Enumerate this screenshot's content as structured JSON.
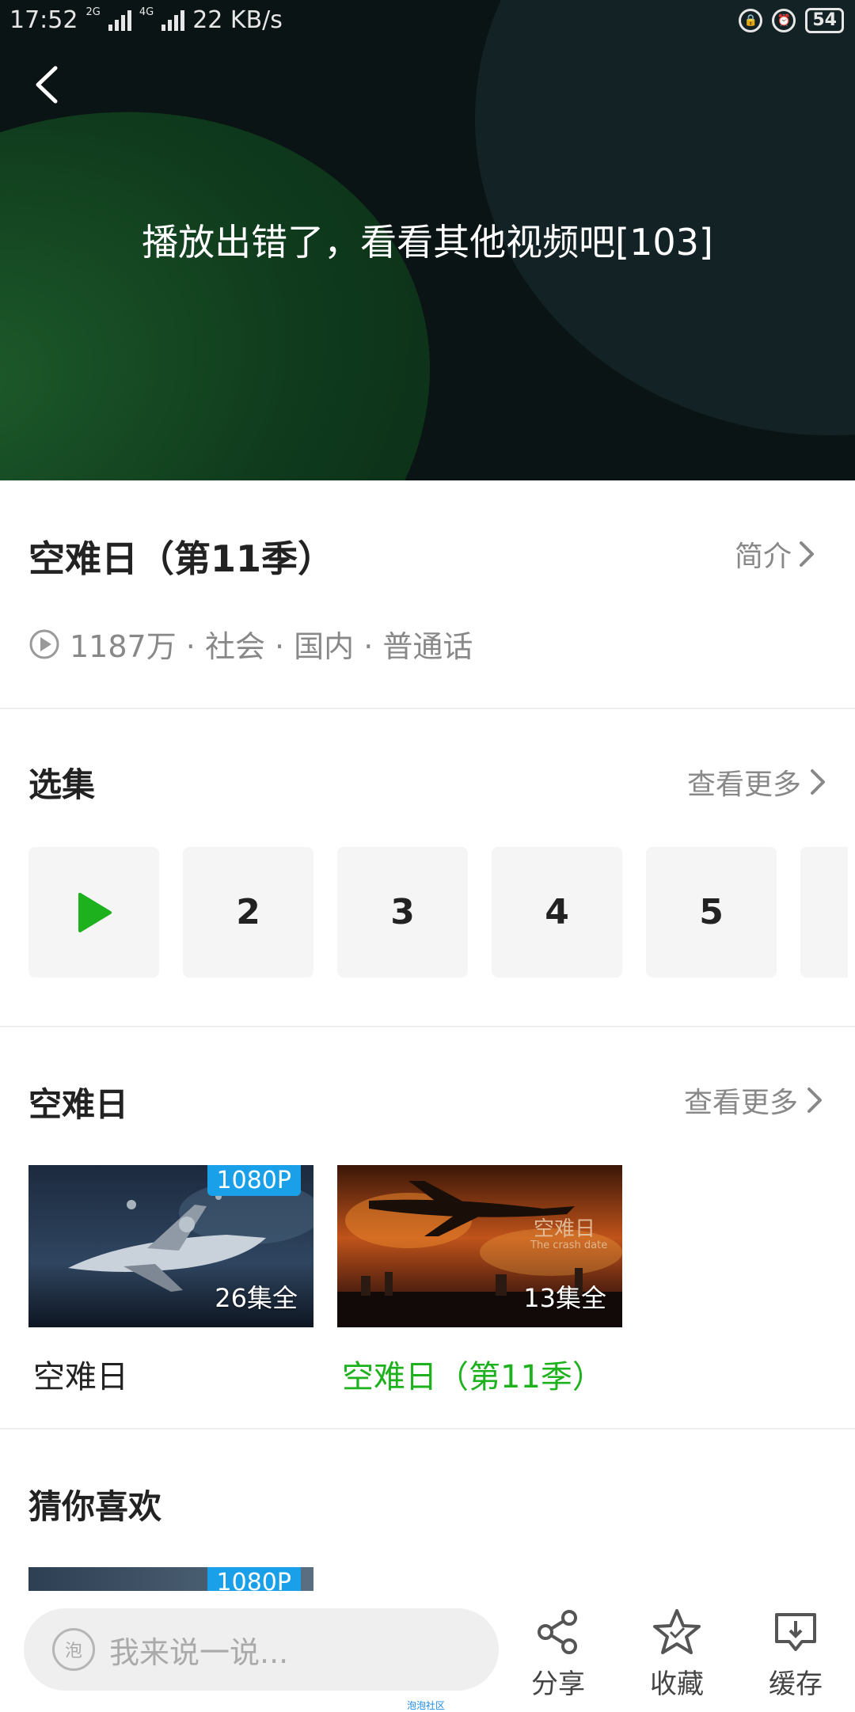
{
  "status_bar": {
    "time": "17:52",
    "net1": "2G",
    "net2": "4G",
    "speed": "22 KB/s",
    "battery": "54"
  },
  "player": {
    "error_text": "播放出错了，看看其他视频吧[103]"
  },
  "info": {
    "title": "空难日（第11季）",
    "intro_label": "简介",
    "meta": "1187万 · 社会 · 国内 · 普通话"
  },
  "episodes": {
    "title": "选集",
    "more_label": "查看更多",
    "items": [
      "2",
      "3",
      "4",
      "5"
    ],
    "accent": "#1db21d"
  },
  "related": {
    "title": "空难日",
    "more_label": "查看更多",
    "cards": [
      {
        "badge": "1080P",
        "count": "26集全",
        "title": "空难日"
      },
      {
        "count": "13集全",
        "title": "空难日（第11季）",
        "thumb_caption": "空难日",
        "thumb_caption_en": "The crash date"
      }
    ]
  },
  "recommend": {
    "title": "猜你喜欢",
    "peek_badge": "1080P"
  },
  "bottom_bar": {
    "comment_placeholder": "我来说一说...",
    "bubble_icon_text": "泡",
    "share_label": "分享",
    "collect_label": "收藏",
    "cache_label": "缓存",
    "footer_text": "泡泡社区"
  }
}
